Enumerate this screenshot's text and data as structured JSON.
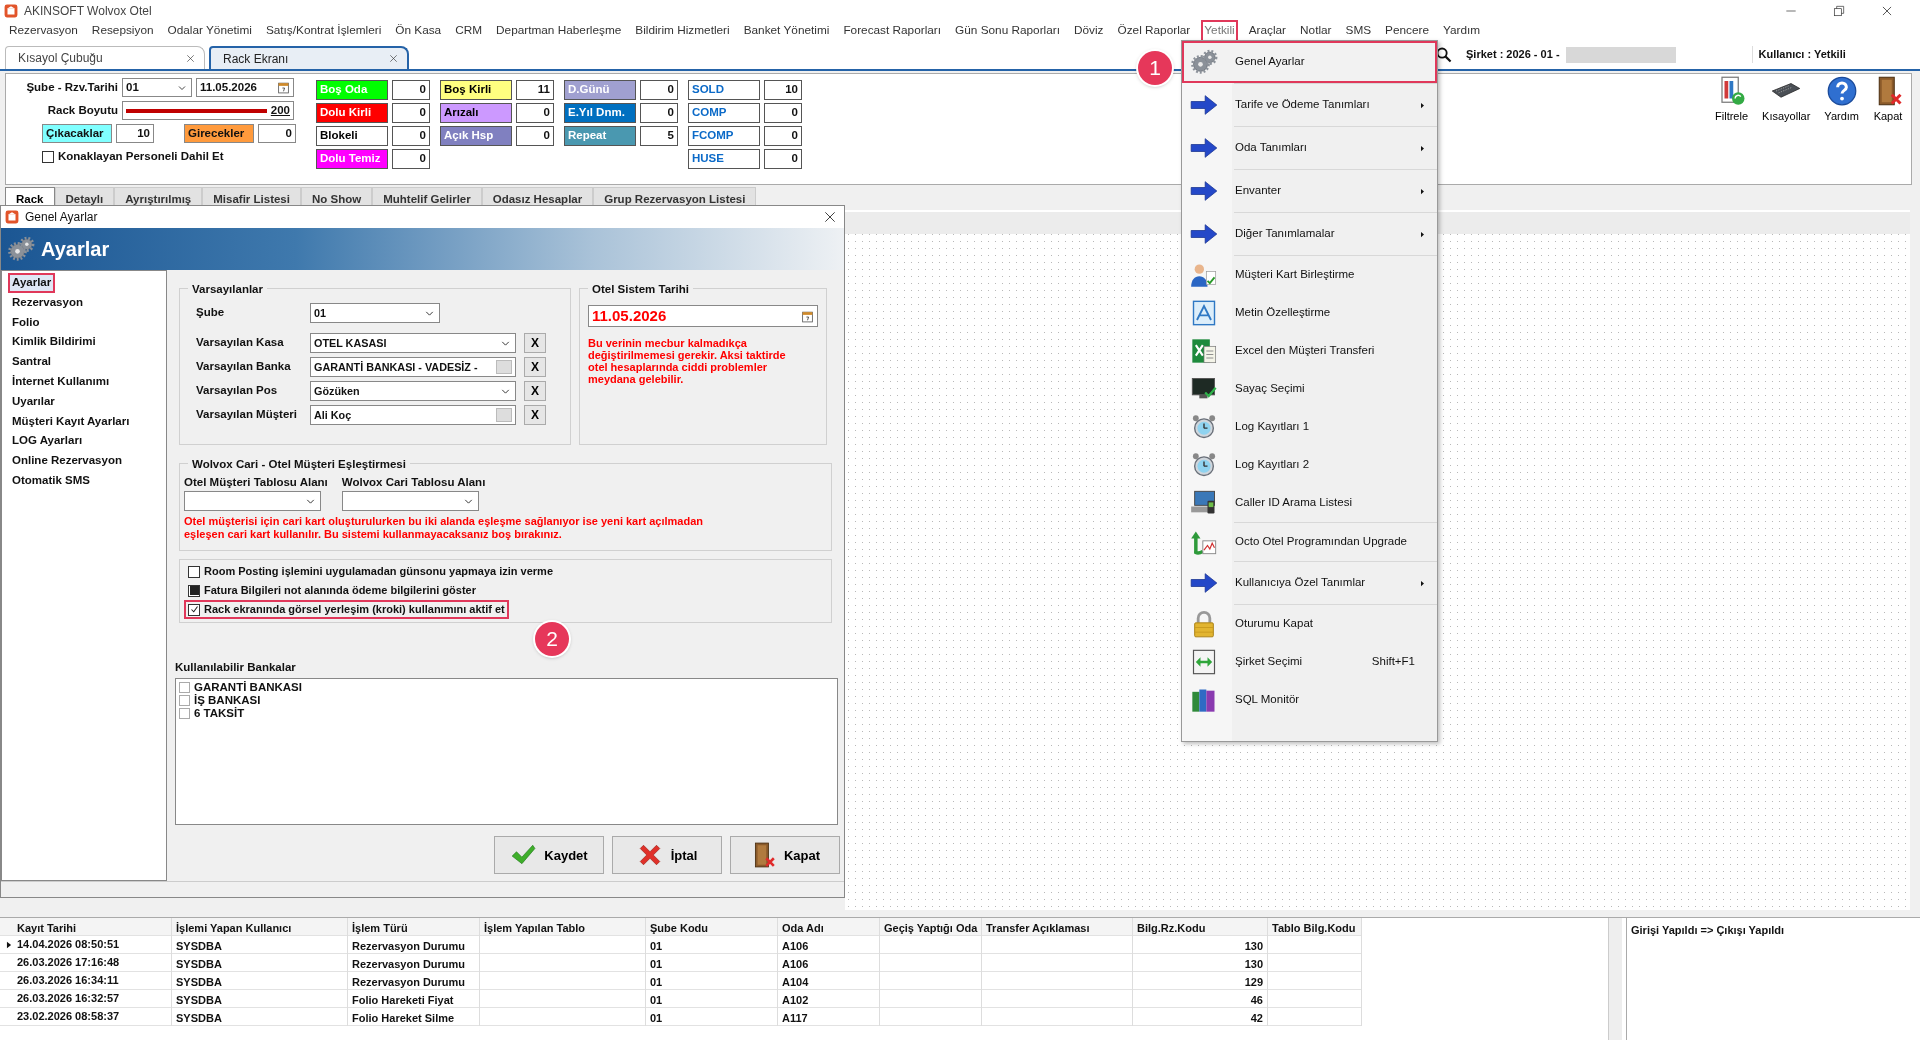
{
  "window": {
    "title": "AKINSOFT Wolvox Otel"
  },
  "menu_bar": [
    {
      "label": "Rezervasyon",
      "selected": false
    },
    {
      "label": "Resepsiyon",
      "selected": false
    },
    {
      "label": "Odalar Yönetimi",
      "selected": false
    },
    {
      "label": "Satış/Kontrat İşlemleri",
      "selected": false
    },
    {
      "label": "Ön Kasa",
      "selected": false
    },
    {
      "label": "CRM",
      "selected": false
    },
    {
      "label": "Departman Haberleşme",
      "selected": false
    },
    {
      "label": "Bildirim Hizmetleri",
      "selected": false
    },
    {
      "label": "Banket Yönetimi",
      "selected": false
    },
    {
      "label": "Forecast Raporları",
      "selected": false
    },
    {
      "label": "Gün Sonu Raporları",
      "selected": false
    },
    {
      "label": "Döviz",
      "selected": false
    },
    {
      "label": "Özel Raporlar",
      "selected": false
    },
    {
      "label": "Yetkili",
      "selected": true
    },
    {
      "label": "Araçlar",
      "selected": false
    },
    {
      "label": "Notlar",
      "selected": false
    },
    {
      "label": "SMS",
      "selected": false
    },
    {
      "label": "Pencere",
      "selected": false
    },
    {
      "label": "Yardım",
      "selected": false
    }
  ],
  "doc_tabs": [
    {
      "label": "Kısayol Çubuğu",
      "selected": false
    },
    {
      "label": "Rack Ekranı",
      "selected": true
    }
  ],
  "company_bar": {
    "company": "Şirket : 2026 - 01 -",
    "user": "Kullanıcı : Yetkili"
  },
  "toolbar": [
    {
      "label": "Filtrele",
      "kind": "filter"
    },
    {
      "label": "Kısayollar",
      "kind": "keyboard"
    },
    {
      "label": "Yardım",
      "kind": "help"
    },
    {
      "label": "Kapat",
      "kind": "exit"
    }
  ],
  "rack": {
    "branch_label": "Şube - Rzv.Tarihi",
    "branch": "01",
    "date": "11.05.2026",
    "size_label": "Rack Boyutu",
    "size": {
      "value": "200",
      "level": 1
    },
    "counters": [
      {
        "label": "Çıkacaklar",
        "value": "10",
        "color": "#80ffff"
      },
      {
        "label": "Girecekler",
        "value": "0",
        "color": "#ff9a3c"
      }
    ],
    "staff_option": {
      "label": "Konaklayan Personeli Dahil Et",
      "checked": false
    },
    "status_groups": [
      {
        "items": [
          {
            "label": "Boş Oda",
            "value": "0",
            "kind": "status",
            "color": "#00ff00"
          },
          {
            "label": "Dolu Kirli",
            "value": "0",
            "kind": "status",
            "color": "#ff0000"
          },
          {
            "label": "Blokeli",
            "value": "0",
            "kind": "status",
            "color": "#ffffff"
          },
          {
            "label": "Dolu Temiz",
            "value": "0",
            "kind": "status",
            "color": "#ff00ff"
          }
        ]
      },
      {
        "items": [
          {
            "label": "Boş Kirli",
            "value": "11",
            "kind": "status",
            "color": "#ffff80"
          },
          {
            "label": "Arızalı",
            "value": "0",
            "kind": "status",
            "color": "#cc99ff"
          },
          {
            "label": "Açık Hsp",
            "value": "0",
            "kind": "status",
            "color": "#8080c0"
          }
        ]
      },
      {
        "items": [
          {
            "label": "D.Günü",
            "value": "0",
            "kind": "status",
            "color": "#a0a0d0"
          },
          {
            "label": "E.Yıl Dnm.",
            "value": "0",
            "kind": "status",
            "color": "#0070c0"
          },
          {
            "label": "Repeat",
            "value": "5",
            "kind": "status",
            "color": "#4a98b0"
          }
        ]
      },
      {
        "items": [
          {
            "label": "SOLD",
            "value": "10",
            "kind": "code"
          },
          {
            "label": "COMP",
            "value": "0",
            "kind": "code"
          },
          {
            "label": "FCOMP",
            "value": "0",
            "kind": "code"
          },
          {
            "label": "HUSE",
            "value": "0",
            "kind": "code"
          }
        ]
      }
    ]
  },
  "view_tabs": [
    {
      "label": "Rack",
      "selected": true
    },
    {
      "label": "Detaylı",
      "selected": false
    },
    {
      "label": "Ayrıştırılmış",
      "selected": false
    },
    {
      "label": "Misafir Listesi",
      "selected": false
    },
    {
      "label": "No Show",
      "selected": false
    },
    {
      "label": "Muhtelif Gelirler",
      "selected": false
    },
    {
      "label": "Odasız Hesaplar",
      "selected": false
    },
    {
      "label": "Grup Rezervasyon Listesi",
      "selected": false
    }
  ],
  "dialog": {
    "title": "Genel Ayarlar",
    "header": "Ayarlar",
    "nav": [
      {
        "label": "Ayarlar",
        "selected": true
      },
      {
        "label": "Rezervasyon",
        "selected": false
      },
      {
        "label": "Folio",
        "selected": false
      },
      {
        "label": "Kimlik Bildirimi",
        "selected": false
      },
      {
        "label": "Santral",
        "selected": false
      },
      {
        "label": "İnternet Kullanımı",
        "selected": false
      },
      {
        "label": "Uyarılar",
        "selected": false
      },
      {
        "label": "Müşteri Kayıt Ayarları",
        "selected": false
      },
      {
        "label": "LOG Ayarları",
        "selected": false
      },
      {
        "label": "Online Rezervasyon",
        "selected": false
      },
      {
        "label": "Otomatik SMS",
        "selected": false
      }
    ],
    "defaults": {
      "title": "Varsayılanlar",
      "fields": [
        {
          "label": "Şube",
          "kind": "select",
          "value": "01"
        },
        {
          "label": "Varsayılan Kasa",
          "kind": "select",
          "value": "OTEL KASASI",
          "clear": "X"
        },
        {
          "label": "Varsayılan Banka",
          "kind": "lookup",
          "value": "GARANTİ BANKASI - VADESİZ -",
          "clear": "X"
        },
        {
          "label": "Varsayılan Pos",
          "kind": "select",
          "value": "Gözüken",
          "clear": "X"
        },
        {
          "label": "Varsayılan Müşteri",
          "kind": "lookup",
          "value": "Ali Koç",
          "clear": "X"
        }
      ]
    },
    "system_date": {
      "title": "Otel Sistem Tarihi",
      "value": "11.05.2026",
      "warning": "Bu verinin mecbur kalmadıkça değiştirilmemesi gerekir. Aksi taktirde otel hesaplarında ciddi problemler meydana gelebilir."
    },
    "matching": {
      "title": "Wolvox Cari - Otel Müşteri Eşleştirmesi",
      "fields": [
        {
          "label": "Otel Müşteri Tablosu Alanı"
        },
        {
          "label": "Wolvox Cari Tablosu Alanı"
        }
      ],
      "warning": "Otel müşterisi için cari kart oluşturulurken bu iki alanda eşleşme sağlanıyor ise yeni kart açılmadan eşleşen cari kart kullanılır. Bu sistemi kullanmayacaksanız boş bırakınız."
    },
    "options": [
      {
        "label": "Room Posting işlemini uygulamadan günsonu yapmaya izin verme",
        "checked": false,
        "indeterminate": false
      },
      {
        "label": "Fatura Bilgileri not alanında ödeme bilgilerini göster",
        "checked": false,
        "indeterminate": true
      },
      {
        "label": "Rack ekranında görsel yerleşim (kroki) kullanımını aktif et",
        "checked": true,
        "indeterminate": false,
        "callout": "2"
      }
    ],
    "banks": {
      "title": "Kullanılabilir Bankalar",
      "items": [
        {
          "label": "GARANTİ BANKASI",
          "checked": false
        },
        {
          "label": "İŞ BANKASI",
          "checked": false
        },
        {
          "label": "6 TAKSİT",
          "checked": false
        }
      ]
    },
    "buttons": [
      {
        "label": "Kaydet",
        "kind": "save"
      },
      {
        "label": "İptal",
        "kind": "cancel"
      },
      {
        "label": "Kapat",
        "kind": "exit"
      }
    ]
  },
  "menu": {
    "items": [
      {
        "label": "Genel Ayarlar",
        "kind": "gears",
        "selected": true,
        "callout": "1",
        "separator": true
      },
      {
        "label": "Tarife ve Ödeme Tanımları",
        "kind": "arrow",
        "selected": false,
        "submenu": true,
        "separator": true
      },
      {
        "label": "Oda Tanımları",
        "kind": "arrow",
        "selected": false,
        "submenu": true,
        "separator": true
      },
      {
        "label": "Envanter",
        "kind": "arrow",
        "selected": false,
        "submenu": true,
        "separator": true
      },
      {
        "label": "Diğer Tanımlamalar",
        "kind": "arrow",
        "selected": false,
        "submenu": true,
        "separator": true
      },
      {
        "label": "Müşteri Kart Birleştirme",
        "kind": "people",
        "selected": false
      },
      {
        "label": "Metin Özelleştirme",
        "kind": "document",
        "selected": false
      },
      {
        "label": "Excel den Müşteri Transferi",
        "kind": "spreadsheet",
        "selected": false
      },
      {
        "label": "Sayaç Seçimi",
        "kind": "monitor",
        "selected": false
      },
      {
        "label": "Log Kayıtları 1",
        "kind": "clock",
        "selected": false
      },
      {
        "label": "Log Kayıtları 2",
        "kind": "clock",
        "selected": false
      },
      {
        "label": "Caller ID Arama Listesi",
        "kind": "computer",
        "selected": false,
        "separator": true
      },
      {
        "label": "Octo Otel Programından Upgrade",
        "kind": "upgrade",
        "selected": false,
        "separator": true
      },
      {
        "label": "Kullanıcıya Özel Tanımlar",
        "kind": "arrow",
        "selected": false,
        "submenu": true,
        "separator": true
      },
      {
        "label": "Oturumu Kapat",
        "kind": "lock",
        "selected": false
      },
      {
        "label": "Şirket Seçimi",
        "kind": "swap",
        "selected": false,
        "shortcut": "Shift+F1"
      },
      {
        "label": "SQL Monitör",
        "kind": "books",
        "selected": false
      }
    ]
  },
  "log": {
    "columns": [
      {
        "label": "Kayıt Tarihi"
      },
      {
        "label": "İşlemi Yapan Kullanıcı"
      },
      {
        "label": "İşlem Türü"
      },
      {
        "label": "İşlem Yapılan Tablo"
      },
      {
        "label": "Şube Kodu"
      },
      {
        "label": "Oda Adı"
      },
      {
        "label": "Geçiş Yaptığı Oda"
      },
      {
        "label": "Transfer Açıklaması"
      },
      {
        "label": "Bilg.Rz.Kodu"
      },
      {
        "label": "Tablo Bilg.Kodu"
      }
    ],
    "rows": [
      {
        "current": true,
        "cells": [
          "14.04.2026 08:50:51",
          "SYSDBA",
          "Rezervasyon Durumu",
          null,
          "01",
          "A106",
          null,
          null,
          "130",
          null
        ]
      },
      {
        "current": false,
        "cells": [
          "26.03.2026 17:16:48",
          "SYSDBA",
          "Rezervasyon Durumu",
          null,
          "01",
          "A106",
          null,
          null,
          "130",
          null
        ]
      },
      {
        "current": false,
        "cells": [
          "26.03.2026 16:34:11",
          "SYSDBA",
          "Rezervasyon Durumu",
          null,
          "01",
          "A104",
          null,
          null,
          "129",
          null
        ]
      },
      {
        "current": false,
        "cells": [
          "26.03.2026 16:32:57",
          "SYSDBA",
          "Folio Hareketi Fiyat",
          null,
          "01",
          "A102",
          null,
          null,
          "46",
          null
        ]
      },
      {
        "current": false,
        "cells": [
          "23.02.2026 08:58:37",
          "SYSDBA",
          "Folio Hareket Silme",
          null,
          "01",
          "A117",
          null,
          null,
          "42",
          null
        ]
      }
    ],
    "side_panel": "Girişi Yapıldı => Çıkışı Yapıldı"
  }
}
